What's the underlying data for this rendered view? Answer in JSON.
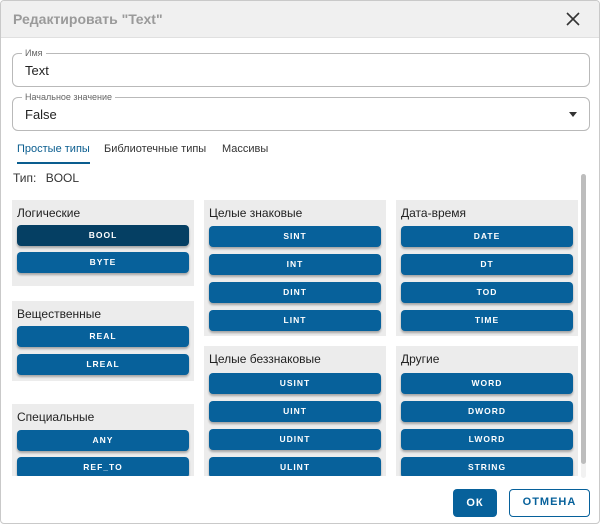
{
  "dialog": {
    "title": "Редактировать \"Text\"",
    "close_icon": "close-icon"
  },
  "name_field": {
    "legend": "Имя",
    "value": "Text"
  },
  "initial_field": {
    "legend": "Начальное значение",
    "value": "False",
    "arrow_icon": "dropdown-arrow-icon"
  },
  "tabs": [
    {
      "label": "Простые типы",
      "active": true
    },
    {
      "label": "Библиотечные типы",
      "active": false
    },
    {
      "label": "Массивы",
      "active": false
    }
  ],
  "type_line": {
    "label": "Тип:",
    "value": "BOOL"
  },
  "groups": {
    "logical": {
      "title": "Логические",
      "items": [
        "BOOL",
        "BYTE"
      ],
      "selected": "BOOL"
    },
    "real": {
      "title": "Вещественные",
      "items": [
        "REAL",
        "LREAL"
      ]
    },
    "special": {
      "title": "Специальные",
      "items": [
        "ANY",
        "REF_TO"
      ]
    },
    "signed": {
      "title": "Целые знаковые",
      "items": [
        "SINT",
        "INT",
        "DINT",
        "LINT"
      ]
    },
    "unsigned": {
      "title": "Целые беззнаковые",
      "items": [
        "USINT",
        "UINT",
        "UDINT",
        "ULINT"
      ]
    },
    "datetime": {
      "title": "Дата-время",
      "items": [
        "DATE",
        "DT",
        "TOD",
        "TIME"
      ]
    },
    "other": {
      "title": "Другие",
      "items": [
        "WORD",
        "DWORD",
        "LWORD",
        "STRING"
      ]
    }
  },
  "footer": {
    "ok_label": "ОК",
    "cancel_label": "ОТМЕНА"
  },
  "colors": {
    "accent": "#07619b",
    "selected": "#053f63",
    "group_bg": "#ececec"
  }
}
